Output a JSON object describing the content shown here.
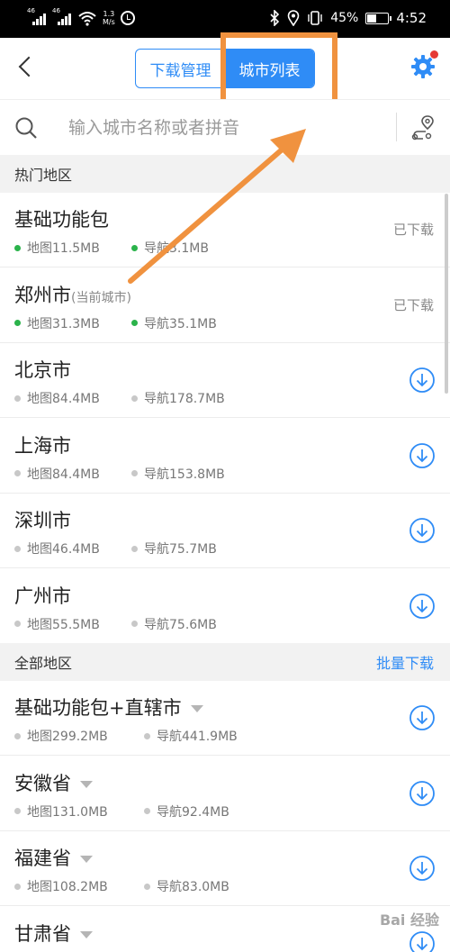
{
  "status_bar": {
    "signal1": "46",
    "signal2": "46",
    "speed_value": "1.3",
    "speed_unit": "M/s",
    "battery": "45%",
    "battery_level": 0.45,
    "time": "4:52"
  },
  "header": {
    "tabs": [
      {
        "label": "下载管理",
        "active": false
      },
      {
        "label": "城市列表",
        "active": true
      }
    ]
  },
  "search": {
    "placeholder": "输入城市名称或者拼音"
  },
  "hot_section": {
    "title": "热门地区",
    "items": [
      {
        "name": "基础功能包",
        "sub": "",
        "map_size": "地图11.5MB",
        "nav_size": "导航3.1MB",
        "status": "已下载",
        "downloaded": true
      },
      {
        "name": "郑州市",
        "sub": "(当前城市)",
        "map_size": "地图31.3MB",
        "nav_size": "导航35.1MB",
        "status": "已下载",
        "downloaded": true
      },
      {
        "name": "北京市",
        "sub": "",
        "map_size": "地图84.4MB",
        "nav_size": "导航178.7MB",
        "status": "",
        "downloaded": false
      },
      {
        "name": "上海市",
        "sub": "",
        "map_size": "地图84.4MB",
        "nav_size": "导航153.8MB",
        "status": "",
        "downloaded": false
      },
      {
        "name": "深圳市",
        "sub": "",
        "map_size": "地图46.4MB",
        "nav_size": "导航75.7MB",
        "status": "",
        "downloaded": false
      },
      {
        "name": "广州市",
        "sub": "",
        "map_size": "地图55.5MB",
        "nav_size": "导航75.6MB",
        "status": "",
        "downloaded": false
      }
    ]
  },
  "all_section": {
    "title": "全部地区",
    "batch_label": "批量下载",
    "items": [
      {
        "name": "基础功能包+直辖市",
        "map_size": "地图299.2MB",
        "nav_size": "导航441.9MB"
      },
      {
        "name": "安徽省",
        "map_size": "地图131.0MB",
        "nav_size": "导航92.4MB"
      },
      {
        "name": "福建省",
        "map_size": "地图108.2MB",
        "nav_size": "导航83.0MB"
      },
      {
        "name": "甘肃省",
        "map_size": "",
        "nav_size": ""
      }
    ]
  },
  "watermark": "Bai 经验",
  "colors": {
    "accent": "#2f8cf6",
    "highlight": "#f0923f",
    "downloaded_dot": "#2bb34b",
    "notification_dot": "#e53935"
  }
}
